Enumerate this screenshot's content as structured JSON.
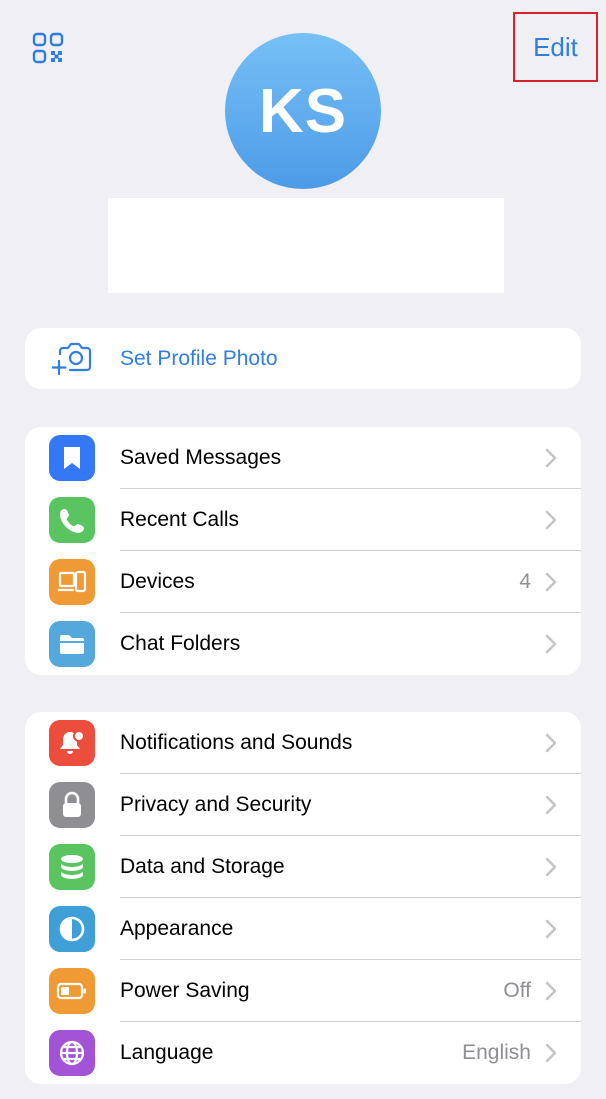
{
  "header": {
    "edit_label": "Edit"
  },
  "profile": {
    "initials": "KS",
    "avatar_gradient": [
      "#76c0f5",
      "#4d9be8"
    ]
  },
  "set_photo": {
    "label": "Set Profile Photo",
    "icon": "camera-add-icon"
  },
  "group1": [
    {
      "label": "Saved Messages",
      "value": "",
      "icon": "bookmark-icon",
      "color": "#3478f6"
    },
    {
      "label": "Recent Calls",
      "value": "",
      "icon": "phone-icon",
      "color": "#5ac461"
    },
    {
      "label": "Devices",
      "value": "4",
      "icon": "devices-icon",
      "color": "#f09a36"
    },
    {
      "label": "Chat Folders",
      "value": "",
      "icon": "folder-icon",
      "color": "#54a8db"
    }
  ],
  "group2": [
    {
      "label": "Notifications and Sounds",
      "value": "",
      "icon": "bell-icon",
      "color": "#ec4d3d"
    },
    {
      "label": "Privacy and Security",
      "value": "",
      "icon": "lock-icon",
      "color": "#8e8e93"
    },
    {
      "label": "Data and Storage",
      "value": "",
      "icon": "database-icon",
      "color": "#5ac461"
    },
    {
      "label": "Appearance",
      "value": "",
      "icon": "appearance-icon",
      "color": "#3fa0d8"
    },
    {
      "label": "Power Saving",
      "value": "Off",
      "icon": "battery-icon",
      "color": "#f09a36"
    },
    {
      "label": "Language",
      "value": "English",
      "icon": "globe-icon",
      "color": "#a354d6"
    }
  ],
  "colors": {
    "accent": "#2f7ee0",
    "background": "#efeff4",
    "highlight_border": "#d6212a"
  }
}
